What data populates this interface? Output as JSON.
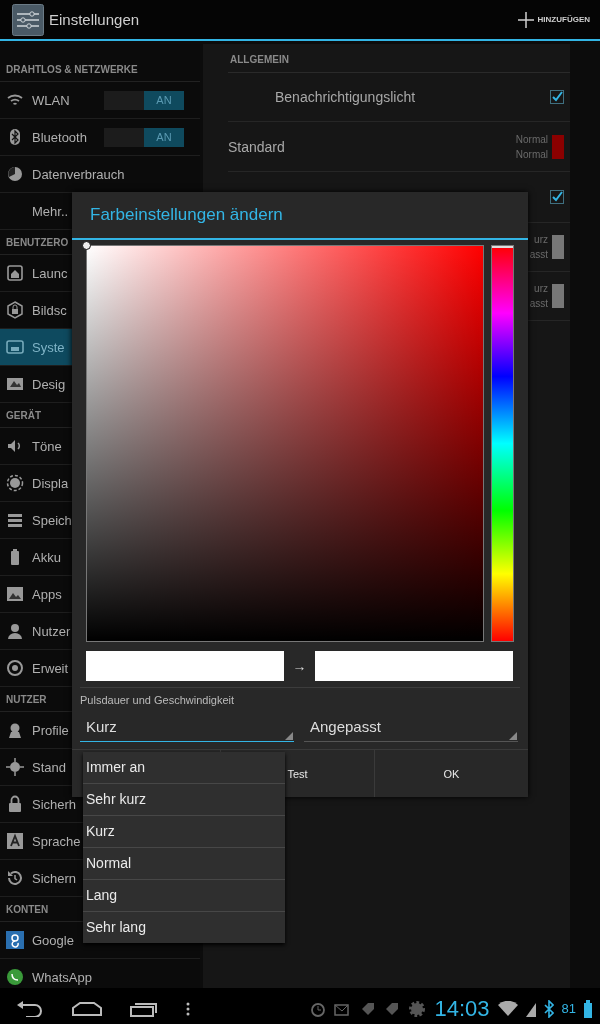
{
  "action_bar": {
    "title": "Einstellungen",
    "action": "HINZUFÜGEN"
  },
  "sidebar": {
    "sections": [
      {
        "header": "DRAHTLOS & NETZWERKE",
        "items": [
          {
            "label": "WLAN",
            "kind": "toggle",
            "toggle": "AN",
            "on": true,
            "selected": false
          },
          {
            "label": "Bluetooth",
            "kind": "toggle",
            "toggle": "AN",
            "on": true,
            "selected": false
          },
          {
            "label": "Datenverbrauch",
            "kind": "link",
            "selected": false
          },
          {
            "label": "Mehr..",
            "kind": "link",
            "selected": false
          }
        ]
      },
      {
        "header": "BENUTZERO",
        "items": [
          {
            "label": "Launc",
            "kind": "link",
            "selected": false
          },
          {
            "label": "Bildsc",
            "kind": "link",
            "selected": false
          },
          {
            "label": "Syste",
            "kind": "link",
            "selected": true
          },
          {
            "label": "Desig",
            "kind": "link",
            "selected": false
          }
        ]
      },
      {
        "header": "GERÄT",
        "items": [
          {
            "label": "Töne",
            "kind": "link",
            "selected": false
          },
          {
            "label": "Displa",
            "kind": "link",
            "selected": false
          },
          {
            "label": "Speich",
            "kind": "link",
            "selected": false
          },
          {
            "label": "Akku",
            "kind": "link",
            "selected": false
          },
          {
            "label": "Apps",
            "kind": "link",
            "selected": false
          },
          {
            "label": "Nutzer",
            "kind": "link",
            "selected": false
          },
          {
            "label": "Erweit",
            "kind": "link",
            "selected": false
          }
        ]
      },
      {
        "header": "NUTZER",
        "items": [
          {
            "label": "Profile",
            "kind": "link",
            "selected": false
          },
          {
            "label": "Stand",
            "kind": "link",
            "selected": false
          },
          {
            "label": "Sicherh",
            "kind": "link",
            "selected": false
          },
          {
            "label": "Sprache",
            "kind": "link",
            "selected": false
          },
          {
            "label": "Sichern",
            "kind": "link",
            "selected": false
          }
        ]
      },
      {
        "header": "KONTEN",
        "items": [
          {
            "label": "Google",
            "kind": "link",
            "selected": false
          },
          {
            "label": "WhatsApp",
            "kind": "link",
            "selected": false
          }
        ]
      }
    ]
  },
  "preferences": {
    "header": "ALLGEMEIN",
    "rows": [
      {
        "kind": "check",
        "title": "Benachrichtigungslicht",
        "checked": true
      },
      {
        "kind": "color",
        "title": "Standard",
        "line1": "Normal",
        "line2": "Normal",
        "color": "#8b0000"
      },
      {
        "kind": "check",
        "checked": true
      },
      {
        "kind": "color",
        "line1": "urz",
        "line2": "asst",
        "color": "#777777"
      },
      {
        "kind": "color",
        "line1": "urz",
        "line2": "asst",
        "color": "#777777"
      }
    ]
  },
  "dialog": {
    "title": "Farbeinstellungen ändern",
    "hue_slider": {
      "level": 0
    },
    "arrow": "→",
    "pulse_label": "Pulsdauer und Geschwindigkeit",
    "spinners": [
      {
        "value": "Kurz",
        "expanded": true
      },
      {
        "value": "Angepasst",
        "expanded": false
      }
    ],
    "buttons": [
      "Test",
      "OK"
    ]
  },
  "dropdown": {
    "options": [
      "Immer an",
      "Sehr kurz",
      "Kurz",
      "Normal",
      "Lang",
      "Sehr lang"
    ]
  },
  "status_bar": {
    "time": "14:03",
    "battery": "81"
  }
}
